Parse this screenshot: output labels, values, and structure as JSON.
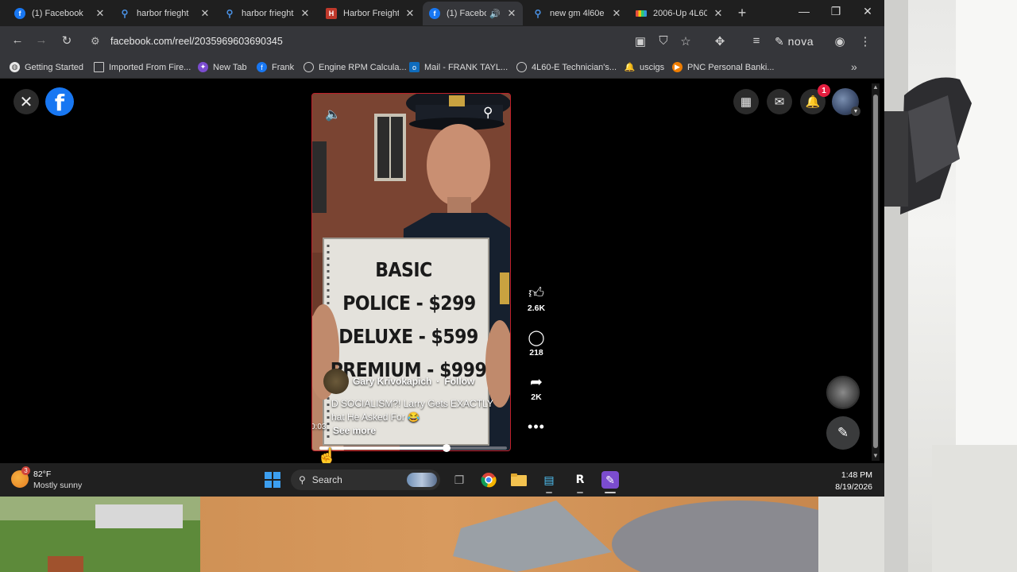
{
  "tabs": [
    {
      "title": "(1) Facebook",
      "icon": "facebook-icon"
    },
    {
      "title": "harbor frieght",
      "icon": "search-icon"
    },
    {
      "title": "harbor frieght",
      "icon": "search-icon"
    },
    {
      "title": "Harbor Freight",
      "icon": "harbor-freight-icon"
    },
    {
      "title": "(1) Facebo",
      "icon": "facebook-icon",
      "active": true
    },
    {
      "title": "new gm 4l60e",
      "icon": "search-icon"
    },
    {
      "title": "2006-Up 4L60",
      "icon": "microsoft-icon"
    }
  ],
  "toolbar": {
    "url": "facebook.com/reel/2035969603690345",
    "nova_label": "nova"
  },
  "bookmarks": [
    {
      "label": "Getting Started",
      "icon": "firefox-icon"
    },
    {
      "label": "Imported From Fire...",
      "icon": "folder-icon"
    },
    {
      "label": "New Tab",
      "icon": "newtab-icon"
    },
    {
      "label": "Frank",
      "icon": "facebook-icon"
    },
    {
      "label": "Engine RPM Calcula...",
      "icon": "globe-icon"
    },
    {
      "label": "Mail - FRANK TAYL...",
      "icon": "outlook-icon"
    },
    {
      "label": "4L60-E Technician's...",
      "icon": "globe-icon"
    },
    {
      "label": "uscigs",
      "icon": "bell-icon"
    },
    {
      "label": "PNC Personal Banki...",
      "icon": "pnc-icon"
    }
  ],
  "header": {
    "notification_count": "1"
  },
  "reel": {
    "sign_lines": [
      "BASIC",
      "POLICE - $299",
      "DELUXE - $599",
      "PREMIUM - $999"
    ],
    "author": "Gary Krivokapich",
    "follow_label": "Follow",
    "caption_line1": "D SOCIALISM?! Larry Gets EXACTLY",
    "caption_line2": "hat He Asked For 😂",
    "see_more": "See more",
    "time": "0:03",
    "progress": 0.68
  },
  "actions": {
    "likes": "2.6K",
    "comments": "218",
    "shares": "2K"
  },
  "taskbar": {
    "temperature": "82°F",
    "condition": "Mostly sunny",
    "weather_badge": "3",
    "search_label": "Search",
    "time": "1:48 PM",
    "date": "8/19/2026"
  }
}
